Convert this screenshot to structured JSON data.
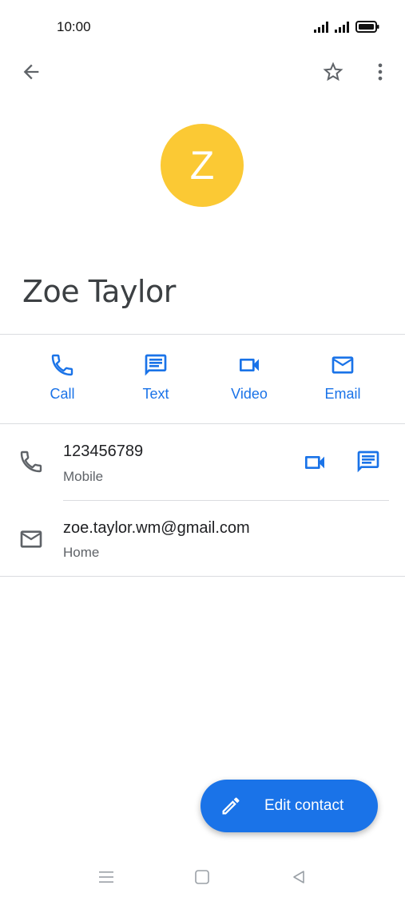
{
  "status_bar": {
    "time": "10:00"
  },
  "top_bar": {
    "back_icon": "arrow-left-icon",
    "star_icon": "star-outline-icon",
    "more_icon": "more-vertical-icon"
  },
  "contact": {
    "initial": "Z",
    "avatar_color": "#fbc934",
    "name": "Zoe Taylor"
  },
  "actions": [
    {
      "label": "Call",
      "icon": "phone-icon"
    },
    {
      "label": "Text",
      "icon": "message-icon"
    },
    {
      "label": "Video",
      "icon": "video-icon"
    },
    {
      "label": "Email",
      "icon": "email-icon"
    }
  ],
  "details": {
    "phone": {
      "number": "123456789",
      "type": "Mobile"
    },
    "email": {
      "address": "zoe.taylor.wm@gmail.com",
      "type": "Home"
    }
  },
  "fab": {
    "label": "Edit contact",
    "icon": "pencil-icon"
  },
  "colors": {
    "accent": "#1a73e8",
    "icon_gray": "#5f6368"
  }
}
